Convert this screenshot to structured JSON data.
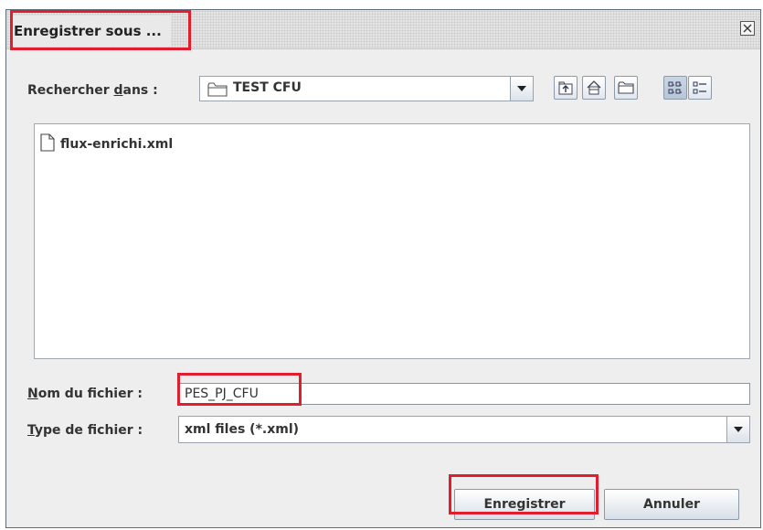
{
  "dialog": {
    "title": "Enregistrer sous ..."
  },
  "look_in": {
    "label_before": "Rechercher ",
    "label_mnemonic": "d",
    "label_after": "ans :",
    "value": "TEST CFU"
  },
  "files": [
    {
      "name": "flux-enrichi.xml"
    }
  ],
  "file_name": {
    "label_mnemonic": "N",
    "label_after": "om du fichier :",
    "value": "PES_PJ_CFU"
  },
  "file_type": {
    "label_mnemonic": "T",
    "label_after": "ype de fichier :",
    "value": "xml files (*.xml)"
  },
  "buttons": {
    "save": "Enregistrer",
    "cancel": "Annuler"
  },
  "colors": {
    "highlight": "#e01e2d",
    "dialog_background": "#eeeeee",
    "border": "#5f6b78"
  }
}
